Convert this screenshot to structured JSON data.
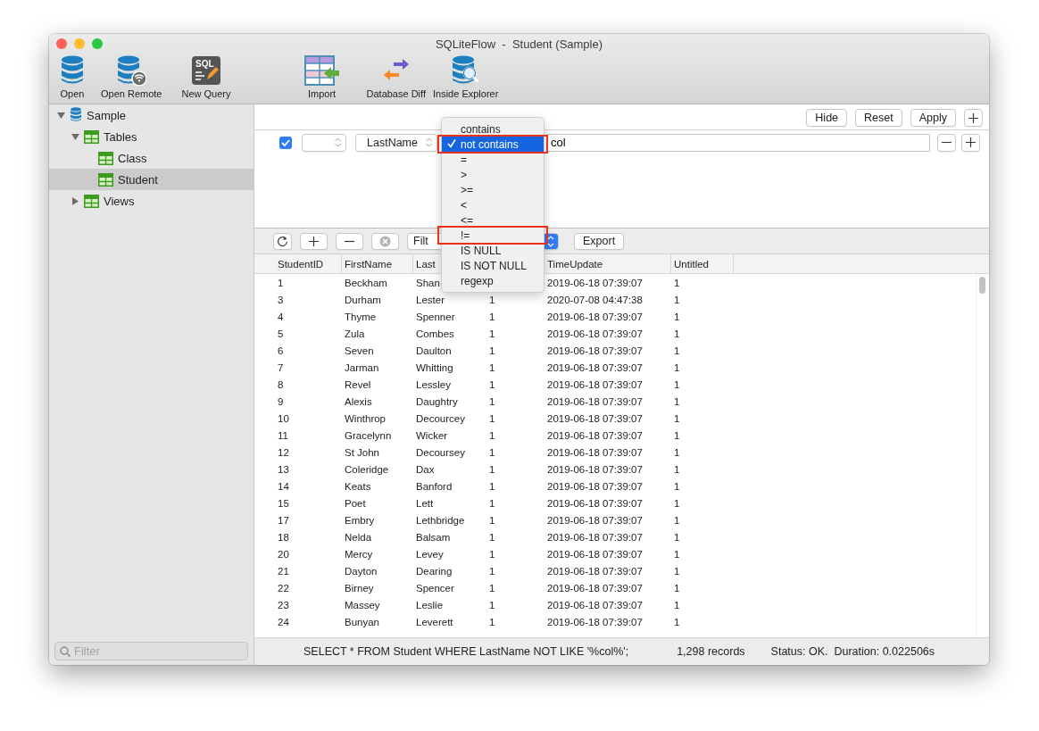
{
  "window": {
    "title": "SQLiteFlow  -  Student (Sample)"
  },
  "toolbar": [
    {
      "label": "Open"
    },
    {
      "label": "Open Remote"
    },
    {
      "label": "New Query",
      "badge": "SQL"
    },
    {
      "label": "Import"
    },
    {
      "label": "Database Diff"
    },
    {
      "label": "Inside Explorer"
    }
  ],
  "sidebar": {
    "tree": [
      {
        "label": "Sample",
        "kind": "database",
        "expanded": true,
        "selected": false,
        "children": [
          {
            "label": "Tables",
            "kind": "group",
            "expanded": true,
            "selected": false,
            "children": [
              {
                "label": "Class",
                "kind": "table",
                "selected": false
              },
              {
                "label": "Student",
                "kind": "table",
                "selected": true
              }
            ]
          },
          {
            "label": "Views",
            "kind": "group",
            "expanded": false,
            "selected": false
          }
        ]
      }
    ],
    "filter_placeholder": "Filter"
  },
  "filter_panel": {
    "buttons": [
      "Hide",
      "Reset",
      "Apply"
    ],
    "conditions": [
      {
        "checked": true,
        "column": "LastName",
        "value": "col"
      }
    ]
  },
  "operator_menu": {
    "items": [
      {
        "label": "contains",
        "selected": false,
        "marked": false
      },
      {
        "label": "not contains",
        "selected": true,
        "marked": true
      },
      {
        "label": "=",
        "selected": false,
        "marked": false
      },
      {
        "label": ">",
        "selected": false,
        "marked": false
      },
      {
        "label": ">=",
        "selected": false,
        "marked": false
      },
      {
        "label": "<",
        "selected": false,
        "marked": false
      },
      {
        "label": "<=",
        "selected": false,
        "marked": false
      },
      {
        "label": "!=",
        "selected": false,
        "marked": true
      },
      {
        "label": "IS NULL",
        "selected": false,
        "marked": false
      },
      {
        "label": "IS NOT NULL",
        "selected": false,
        "marked": false
      },
      {
        "label": "regexp",
        "selected": false,
        "marked": false
      }
    ]
  },
  "actions_bar": {
    "filter_popup": "Filt",
    "export_button": "Export"
  },
  "table": {
    "columns": [
      "StudentID",
      "FirstName",
      "Last",
      null,
      "TimeUpdate",
      "Untitled"
    ],
    "rows": [
      [
        "1",
        "Beckham",
        "Shan",
        null,
        "2019-06-18 07:39:07",
        "1"
      ],
      [
        "3",
        "Durham",
        "Lester",
        "1",
        "2020-07-08 04:47:38",
        "1"
      ],
      [
        "4",
        "Thyme",
        "Spenner",
        "1",
        "2019-06-18 07:39:07",
        "1"
      ],
      [
        "5",
        "Zula",
        "Combes",
        "1",
        "2019-06-18 07:39:07",
        "1"
      ],
      [
        "6",
        "Seven",
        "Daulton",
        "1",
        "2019-06-18 07:39:07",
        "1"
      ],
      [
        "7",
        "Jarman",
        "Whitting",
        "1",
        "2019-06-18 07:39:07",
        "1"
      ],
      [
        "8",
        "Revel",
        "Lessley",
        "1",
        "2019-06-18 07:39:07",
        "1"
      ],
      [
        "9",
        "Alexis",
        "Daughtry",
        "1",
        "2019-06-18 07:39:07",
        "1"
      ],
      [
        "10",
        "Winthrop",
        "Decourcey",
        "1",
        "2019-06-18 07:39:07",
        "1"
      ],
      [
        "11",
        "Gracelynn",
        "Wicker",
        "1",
        "2019-06-18 07:39:07",
        "1"
      ],
      [
        "12",
        "St John",
        "Decoursey",
        "1",
        "2019-06-18 07:39:07",
        "1"
      ],
      [
        "13",
        "Coleridge",
        "Dax",
        "1",
        "2019-06-18 07:39:07",
        "1"
      ],
      [
        "14",
        "Keats",
        "Banford",
        "1",
        "2019-06-18 07:39:07",
        "1"
      ],
      [
        "15",
        "Poet",
        "Lett",
        "1",
        "2019-06-18 07:39:07",
        "1"
      ],
      [
        "17",
        "Embry",
        "Lethbridge",
        "1",
        "2019-06-18 07:39:07",
        "1"
      ],
      [
        "18",
        "Nelda",
        "Balsam",
        "1",
        "2019-06-18 07:39:07",
        "1"
      ],
      [
        "20",
        "Mercy",
        "Levey",
        "1",
        "2019-06-18 07:39:07",
        "1"
      ],
      [
        "21",
        "Dayton",
        "Dearing",
        "1",
        "2019-06-18 07:39:07",
        "1"
      ],
      [
        "22",
        "Birney",
        "Spencer",
        "1",
        "2019-06-18 07:39:07",
        "1"
      ],
      [
        "23",
        "Massey",
        "Leslie",
        "1",
        "2019-06-18 07:39:07",
        "1"
      ],
      [
        "24",
        "Bunyan",
        "Leverett",
        "1",
        "2019-06-18 07:39:07",
        "1"
      ]
    ]
  },
  "status_bar": {
    "query": "SELECT * FROM Student WHERE LastName NOT LIKE '%col%';",
    "records": "1,298 records",
    "status": "Status: OK.  Duration: 0.022506s"
  }
}
